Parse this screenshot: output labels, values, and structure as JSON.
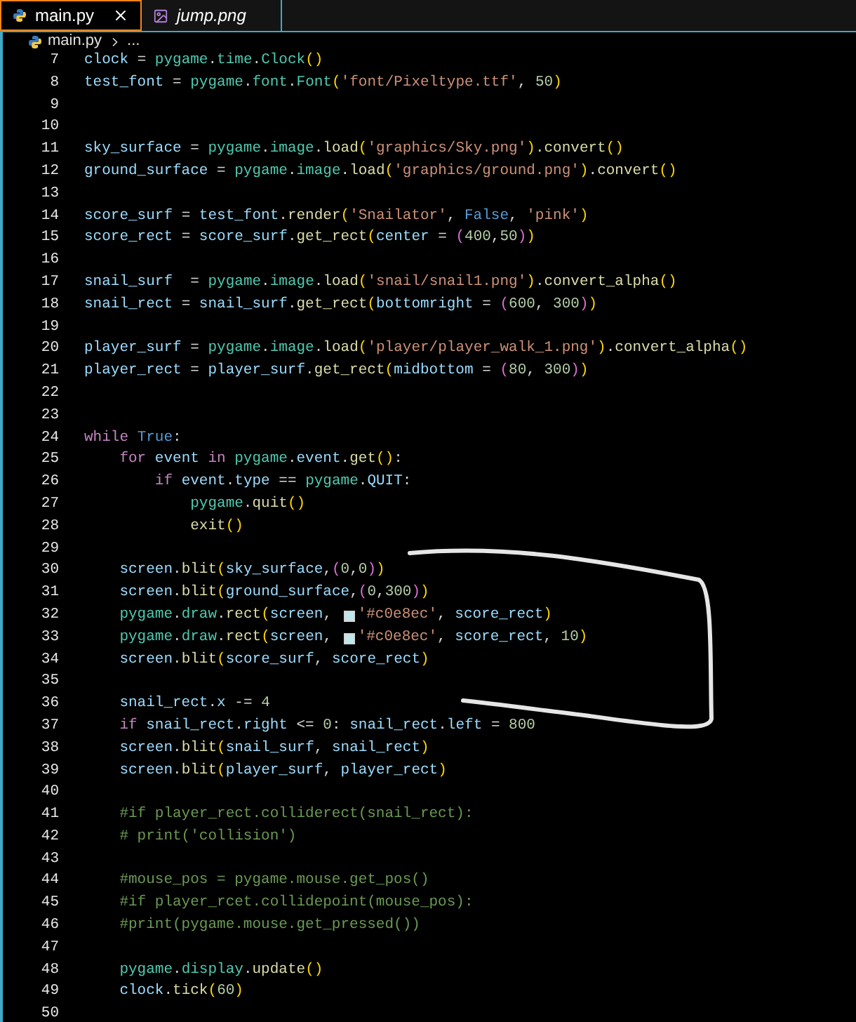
{
  "tabs": [
    {
      "label": "main.py",
      "kind": "python",
      "selected": true,
      "italic": false,
      "closable": true
    },
    {
      "label": "jump.png",
      "kind": "image",
      "selected": false,
      "italic": true,
      "closable": false
    }
  ],
  "breadcrumb": {
    "file": "main.py",
    "rest": "..."
  },
  "lines": [
    {
      "number": "7",
      "tokens": [
        {
          "kind": "v",
          "text": "clock"
        },
        {
          "kind": "p",
          "text": " = "
        },
        {
          "kind": "m",
          "text": "pygame"
        },
        {
          "kind": "p",
          "text": "."
        },
        {
          "kind": "m",
          "text": "time"
        },
        {
          "kind": "p",
          "text": "."
        },
        {
          "kind": "m",
          "text": "Clock"
        },
        {
          "kind": "b1",
          "text": "()"
        }
      ]
    },
    {
      "number": "8",
      "tokens": [
        {
          "kind": "v",
          "text": "test_font"
        },
        {
          "kind": "p",
          "text": " = "
        },
        {
          "kind": "m",
          "text": "pygame"
        },
        {
          "kind": "p",
          "text": "."
        },
        {
          "kind": "m",
          "text": "font"
        },
        {
          "kind": "p",
          "text": "."
        },
        {
          "kind": "m",
          "text": "Font"
        },
        {
          "kind": "b1",
          "text": "("
        },
        {
          "kind": "s",
          "text": "'font/Pixeltype.ttf'"
        },
        {
          "kind": "p",
          "text": ", "
        },
        {
          "kind": "n",
          "text": "50"
        },
        {
          "kind": "b1",
          "text": ")"
        }
      ]
    },
    {
      "number": "9"
    },
    {
      "number": "10"
    },
    {
      "number": "11",
      "tokens": [
        {
          "kind": "v",
          "text": "sky_surface"
        },
        {
          "kind": "p",
          "text": " = "
        },
        {
          "kind": "m",
          "text": "pygame"
        },
        {
          "kind": "p",
          "text": "."
        },
        {
          "kind": "m",
          "text": "image"
        },
        {
          "kind": "p",
          "text": "."
        },
        {
          "kind": "f",
          "text": "load"
        },
        {
          "kind": "b1",
          "text": "("
        },
        {
          "kind": "s",
          "text": "'graphics/Sky.png'"
        },
        {
          "kind": "b1",
          "text": ")"
        },
        {
          "kind": "p",
          "text": "."
        },
        {
          "kind": "f",
          "text": "convert"
        },
        {
          "kind": "b1",
          "text": "()"
        }
      ]
    },
    {
      "number": "12",
      "tokens": [
        {
          "kind": "v",
          "text": "ground_surface"
        },
        {
          "kind": "p",
          "text": " = "
        },
        {
          "kind": "m",
          "text": "pygame"
        },
        {
          "kind": "p",
          "text": "."
        },
        {
          "kind": "m",
          "text": "image"
        },
        {
          "kind": "p",
          "text": "."
        },
        {
          "kind": "f",
          "text": "load"
        },
        {
          "kind": "b1",
          "text": "("
        },
        {
          "kind": "s",
          "text": "'graphics/ground.png'"
        },
        {
          "kind": "b1",
          "text": ")"
        },
        {
          "kind": "p",
          "text": "."
        },
        {
          "kind": "f",
          "text": "convert"
        },
        {
          "kind": "b1",
          "text": "()"
        }
      ]
    },
    {
      "number": "13"
    },
    {
      "number": "14",
      "tokens": [
        {
          "kind": "v",
          "text": "score_surf"
        },
        {
          "kind": "p",
          "text": " = "
        },
        {
          "kind": "v",
          "text": "test_font"
        },
        {
          "kind": "p",
          "text": "."
        },
        {
          "kind": "f",
          "text": "render"
        },
        {
          "kind": "b1",
          "text": "("
        },
        {
          "kind": "s",
          "text": "'Snailator'"
        },
        {
          "kind": "p",
          "text": ", "
        },
        {
          "kind": "c",
          "text": "False"
        },
        {
          "kind": "p",
          "text": ", "
        },
        {
          "kind": "s",
          "text": "'pink'"
        },
        {
          "kind": "b1",
          "text": ")"
        }
      ]
    },
    {
      "number": "15",
      "tokens": [
        {
          "kind": "v",
          "text": "score_rect"
        },
        {
          "kind": "p",
          "text": " = "
        },
        {
          "kind": "v",
          "text": "score_surf"
        },
        {
          "kind": "p",
          "text": "."
        },
        {
          "kind": "f",
          "text": "get_rect"
        },
        {
          "kind": "b1",
          "text": "("
        },
        {
          "kind": "v",
          "text": "center"
        },
        {
          "kind": "p",
          "text": " = "
        },
        {
          "kind": "b2",
          "text": "("
        },
        {
          "kind": "n",
          "text": "400"
        },
        {
          "kind": "p",
          "text": ","
        },
        {
          "kind": "n",
          "text": "50"
        },
        {
          "kind": "b2",
          "text": ")"
        },
        {
          "kind": "b1",
          "text": ")"
        }
      ]
    },
    {
      "number": "16"
    },
    {
      "number": "17",
      "tokens": [
        {
          "kind": "v",
          "text": "snail_surf"
        },
        {
          "kind": "p",
          "text": "  = "
        },
        {
          "kind": "m",
          "text": "pygame"
        },
        {
          "kind": "p",
          "text": "."
        },
        {
          "kind": "m",
          "text": "image"
        },
        {
          "kind": "p",
          "text": "."
        },
        {
          "kind": "f",
          "text": "load"
        },
        {
          "kind": "b1",
          "text": "("
        },
        {
          "kind": "s",
          "text": "'snail/snail1.png'"
        },
        {
          "kind": "b1",
          "text": ")"
        },
        {
          "kind": "p",
          "text": "."
        },
        {
          "kind": "f",
          "text": "convert_alpha"
        },
        {
          "kind": "b1",
          "text": "()"
        }
      ]
    },
    {
      "number": "18",
      "tokens": [
        {
          "kind": "v",
          "text": "snail_rect"
        },
        {
          "kind": "p",
          "text": " = "
        },
        {
          "kind": "v",
          "text": "snail_surf"
        },
        {
          "kind": "p",
          "text": "."
        },
        {
          "kind": "f",
          "text": "get_rect"
        },
        {
          "kind": "b1",
          "text": "("
        },
        {
          "kind": "v",
          "text": "bottomright"
        },
        {
          "kind": "p",
          "text": " = "
        },
        {
          "kind": "b2",
          "text": "("
        },
        {
          "kind": "n",
          "text": "600"
        },
        {
          "kind": "p",
          "text": ", "
        },
        {
          "kind": "n",
          "text": "300"
        },
        {
          "kind": "b2",
          "text": ")"
        },
        {
          "kind": "b1",
          "text": ")"
        }
      ]
    },
    {
      "number": "19"
    },
    {
      "number": "20",
      "tokens": [
        {
          "kind": "v",
          "text": "player_surf"
        },
        {
          "kind": "p",
          "text": " = "
        },
        {
          "kind": "m",
          "text": "pygame"
        },
        {
          "kind": "p",
          "text": "."
        },
        {
          "kind": "m",
          "text": "image"
        },
        {
          "kind": "p",
          "text": "."
        },
        {
          "kind": "f",
          "text": "load"
        },
        {
          "kind": "b1",
          "text": "("
        },
        {
          "kind": "s",
          "text": "'player/player_walk_1.png'"
        },
        {
          "kind": "b1",
          "text": ")"
        },
        {
          "kind": "p",
          "text": "."
        },
        {
          "kind": "f",
          "text": "convert_alpha"
        },
        {
          "kind": "b1",
          "text": "()"
        }
      ]
    },
    {
      "number": "21",
      "tokens": [
        {
          "kind": "v",
          "text": "player_rect"
        },
        {
          "kind": "p",
          "text": " = "
        },
        {
          "kind": "v",
          "text": "player_surf"
        },
        {
          "kind": "p",
          "text": "."
        },
        {
          "kind": "f",
          "text": "get_rect"
        },
        {
          "kind": "b1",
          "text": "("
        },
        {
          "kind": "v",
          "text": "midbottom"
        },
        {
          "kind": "p",
          "text": " = "
        },
        {
          "kind": "b2",
          "text": "("
        },
        {
          "kind": "n",
          "text": "80"
        },
        {
          "kind": "p",
          "text": ", "
        },
        {
          "kind": "n",
          "text": "300"
        },
        {
          "kind": "b2",
          "text": ")"
        },
        {
          "kind": "b1",
          "text": ")"
        }
      ]
    },
    {
      "number": "22"
    },
    {
      "number": "23"
    },
    {
      "number": "24",
      "tokens": [
        {
          "kind": "k",
          "text": "while"
        },
        {
          "kind": "c",
          "text": " True"
        },
        {
          "kind": "p",
          "text": ":"
        }
      ]
    },
    {
      "number": "25",
      "tokens": [
        {
          "kind": "k",
          "text": "    for"
        },
        {
          "kind": "v",
          "text": " event"
        },
        {
          "kind": "k",
          "text": " in"
        },
        {
          "kind": "m",
          "text": " pygame"
        },
        {
          "kind": "p",
          "text": "."
        },
        {
          "kind": "v",
          "text": "event"
        },
        {
          "kind": "p",
          "text": "."
        },
        {
          "kind": "f",
          "text": "get"
        },
        {
          "kind": "b1",
          "text": "()"
        },
        {
          "kind": "p",
          "text": ":"
        }
      ]
    },
    {
      "number": "26",
      "tokens": [
        {
          "kind": "k",
          "text": "        if"
        },
        {
          "kind": "v",
          "text": " event"
        },
        {
          "kind": "p",
          "text": "."
        },
        {
          "kind": "v",
          "text": "type"
        },
        {
          "kind": "p",
          "text": " == "
        },
        {
          "kind": "m",
          "text": "pygame"
        },
        {
          "kind": "p",
          "text": "."
        },
        {
          "kind": "v",
          "text": "QUIT"
        },
        {
          "kind": "p",
          "text": ":"
        }
      ]
    },
    {
      "number": "27",
      "tokens": [
        {
          "kind": "m",
          "text": "            pygame"
        },
        {
          "kind": "p",
          "text": "."
        },
        {
          "kind": "f",
          "text": "quit"
        },
        {
          "kind": "b1",
          "text": "()"
        }
      ]
    },
    {
      "number": "28",
      "tokens": [
        {
          "kind": "f",
          "text": "            exit"
        },
        {
          "kind": "b1",
          "text": "()"
        }
      ]
    },
    {
      "number": "29"
    },
    {
      "number": "30",
      "tokens": [
        {
          "kind": "v",
          "text": "    screen"
        },
        {
          "kind": "p",
          "text": "."
        },
        {
          "kind": "f",
          "text": "blit"
        },
        {
          "kind": "b1",
          "text": "("
        },
        {
          "kind": "v",
          "text": "sky_surface"
        },
        {
          "kind": "p",
          "text": ","
        },
        {
          "kind": "b2",
          "text": "("
        },
        {
          "kind": "n",
          "text": "0"
        },
        {
          "kind": "p",
          "text": ","
        },
        {
          "kind": "n",
          "text": "0"
        },
        {
          "kind": "b2",
          "text": ")"
        },
        {
          "kind": "b1",
          "text": ")"
        }
      ]
    },
    {
      "number": "31",
      "tokens": [
        {
          "kind": "v",
          "text": "    screen"
        },
        {
          "kind": "p",
          "text": "."
        },
        {
          "kind": "f",
          "text": "blit"
        },
        {
          "kind": "b1",
          "text": "("
        },
        {
          "kind": "v",
          "text": "ground_surface"
        },
        {
          "kind": "p",
          "text": ","
        },
        {
          "kind": "b2",
          "text": "("
        },
        {
          "kind": "n",
          "text": "0"
        },
        {
          "kind": "p",
          "text": ","
        },
        {
          "kind": "n",
          "text": "300"
        },
        {
          "kind": "b2",
          "text": ")"
        },
        {
          "kind": "b1",
          "text": ")"
        }
      ]
    },
    {
      "number": "32",
      "tokens": [
        {
          "kind": "m",
          "text": "    pygame"
        },
        {
          "kind": "p",
          "text": "."
        },
        {
          "kind": "m",
          "text": "draw"
        },
        {
          "kind": "p",
          "text": "."
        },
        {
          "kind": "f",
          "text": "rect"
        },
        {
          "kind": "b1",
          "text": "("
        },
        {
          "kind": "v",
          "text": "screen"
        },
        {
          "kind": "p",
          "text": ", "
        },
        {
          "kind": "swatch",
          "color": "#c0e8ec"
        },
        {
          "kind": "s",
          "text": "'#c0e8ec'"
        },
        {
          "kind": "p",
          "text": ", "
        },
        {
          "kind": "v",
          "text": "score_rect"
        },
        {
          "kind": "b1",
          "text": ")"
        }
      ]
    },
    {
      "number": "33",
      "tokens": [
        {
          "kind": "m",
          "text": "    pygame"
        },
        {
          "kind": "p",
          "text": "."
        },
        {
          "kind": "m",
          "text": "draw"
        },
        {
          "kind": "p",
          "text": "."
        },
        {
          "kind": "f",
          "text": "rect"
        },
        {
          "kind": "b1",
          "text": "("
        },
        {
          "kind": "v",
          "text": "screen"
        },
        {
          "kind": "p",
          "text": ", "
        },
        {
          "kind": "swatch",
          "color": "#c0e8ec"
        },
        {
          "kind": "s",
          "text": "'#c0e8ec'"
        },
        {
          "kind": "p",
          "text": ", "
        },
        {
          "kind": "v",
          "text": "score_rect"
        },
        {
          "kind": "p",
          "text": ", "
        },
        {
          "kind": "n",
          "text": "10"
        },
        {
          "kind": "b1",
          "text": ")"
        }
      ]
    },
    {
      "number": "34",
      "tokens": [
        {
          "kind": "v",
          "text": "    screen"
        },
        {
          "kind": "p",
          "text": "."
        },
        {
          "kind": "f",
          "text": "blit"
        },
        {
          "kind": "b1",
          "text": "("
        },
        {
          "kind": "v",
          "text": "score_surf"
        },
        {
          "kind": "p",
          "text": ", "
        },
        {
          "kind": "v",
          "text": "score_rect"
        },
        {
          "kind": "b1",
          "text": ")"
        }
      ]
    },
    {
      "number": "35"
    },
    {
      "number": "36",
      "tokens": [
        {
          "kind": "v",
          "text": "    snail_rect"
        },
        {
          "kind": "p",
          "text": "."
        },
        {
          "kind": "v",
          "text": "x"
        },
        {
          "kind": "p",
          "text": " -= "
        },
        {
          "kind": "n",
          "text": "4"
        }
      ]
    },
    {
      "number": "37",
      "tokens": [
        {
          "kind": "k",
          "text": "    if"
        },
        {
          "kind": "v",
          "text": " snail_rect"
        },
        {
          "kind": "p",
          "text": "."
        },
        {
          "kind": "v",
          "text": "right"
        },
        {
          "kind": "p",
          "text": " <= "
        },
        {
          "kind": "n",
          "text": "0"
        },
        {
          "kind": "p",
          "text": ": "
        },
        {
          "kind": "v",
          "text": "snail_rect"
        },
        {
          "kind": "p",
          "text": "."
        },
        {
          "kind": "v",
          "text": "left"
        },
        {
          "kind": "p",
          "text": " = "
        },
        {
          "kind": "n",
          "text": "800"
        }
      ]
    },
    {
      "number": "38",
      "tokens": [
        {
          "kind": "v",
          "text": "    screen"
        },
        {
          "kind": "p",
          "text": "."
        },
        {
          "kind": "f",
          "text": "blit"
        },
        {
          "kind": "b1",
          "text": "("
        },
        {
          "kind": "v",
          "text": "snail_surf"
        },
        {
          "kind": "p",
          "text": ", "
        },
        {
          "kind": "v",
          "text": "snail_rect"
        },
        {
          "kind": "b1",
          "text": ")"
        }
      ]
    },
    {
      "number": "39",
      "tokens": [
        {
          "kind": "v",
          "text": "    screen"
        },
        {
          "kind": "p",
          "text": "."
        },
        {
          "kind": "f",
          "text": "blit"
        },
        {
          "kind": "b1",
          "text": "("
        },
        {
          "kind": "v",
          "text": "player_surf"
        },
        {
          "kind": "p",
          "text": ", "
        },
        {
          "kind": "v",
          "text": "player_rect"
        },
        {
          "kind": "b1",
          "text": ")"
        }
      ]
    },
    {
      "number": "40"
    },
    {
      "number": "41",
      "tokens": [
        {
          "kind": "cm",
          "text": "    #if player_rect.colliderect(snail_rect):"
        }
      ]
    },
    {
      "number": "42",
      "tokens": [
        {
          "kind": "cm",
          "text": "    # print('collision')"
        }
      ]
    },
    {
      "number": "43"
    },
    {
      "number": "44",
      "tokens": [
        {
          "kind": "cm",
          "text": "    #mouse_pos = pygame.mouse.get_pos()"
        }
      ]
    },
    {
      "number": "45",
      "tokens": [
        {
          "kind": "cm",
          "text": "    #if player_rcet.collidepoint(mouse_pos):"
        }
      ]
    },
    {
      "number": "46",
      "tokens": [
        {
          "kind": "cm",
          "text": "    #print(pygame.mouse.get_pressed())"
        }
      ]
    },
    {
      "number": "47"
    },
    {
      "number": "48",
      "tokens": [
        {
          "kind": "m",
          "text": "    pygame"
        },
        {
          "kind": "p",
          "text": "."
        },
        {
          "kind": "m",
          "text": "display"
        },
        {
          "kind": "p",
          "text": "."
        },
        {
          "kind": "f",
          "text": "update"
        },
        {
          "kind": "b1",
          "text": "()"
        }
      ]
    },
    {
      "number": "49",
      "tokens": [
        {
          "kind": "v",
          "text": "    clock"
        },
        {
          "kind": "p",
          "text": "."
        },
        {
          "kind": "f",
          "text": "tick"
        },
        {
          "kind": "b1",
          "text": "("
        },
        {
          "kind": "n",
          "text": "60"
        },
        {
          "kind": "b1",
          "text": ")"
        }
      ]
    },
    {
      "number": "50"
    }
  ]
}
